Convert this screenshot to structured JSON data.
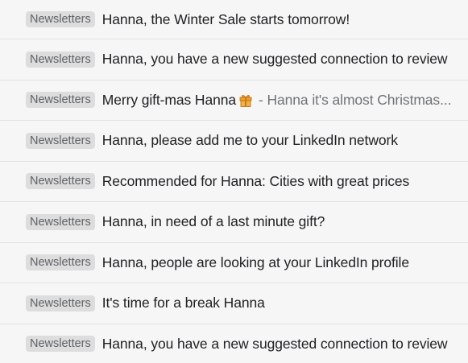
{
  "emails": [
    {
      "label": "Newsletters",
      "subject": "Hanna, the Winter Sale starts tomorrow!"
    },
    {
      "label": "Newsletters",
      "subject": "Hanna, you have a new suggested connection to review"
    },
    {
      "label": "Newsletters",
      "subject": "Merry gift-mas Hanna",
      "icon": "gift-icon",
      "snippet": "- Hanna it's almost Christmas..."
    },
    {
      "label": "Newsletters",
      "subject": "Hanna, please add me to your LinkedIn network"
    },
    {
      "label": "Newsletters",
      "subject": "Recommended for Hanna: Cities with great prices"
    },
    {
      "label": "Newsletters",
      "subject": "Hanna, in need of a last minute gift?"
    },
    {
      "label": "Newsletters",
      "subject": "Hanna, people are looking at your LinkedIn profile"
    },
    {
      "label": "Newsletters",
      "subject": "It's time for a break Hanna"
    },
    {
      "label": "Newsletters",
      "subject": "Hanna, you have a new suggested connection to review"
    }
  ],
  "colors": {
    "background": "#f6f6f6",
    "badge_bg": "#dddddd",
    "badge_text": "#5f6368",
    "subject_text": "#202124",
    "snippet_text": "#6f7377",
    "gift_orange": "#f0a030"
  }
}
